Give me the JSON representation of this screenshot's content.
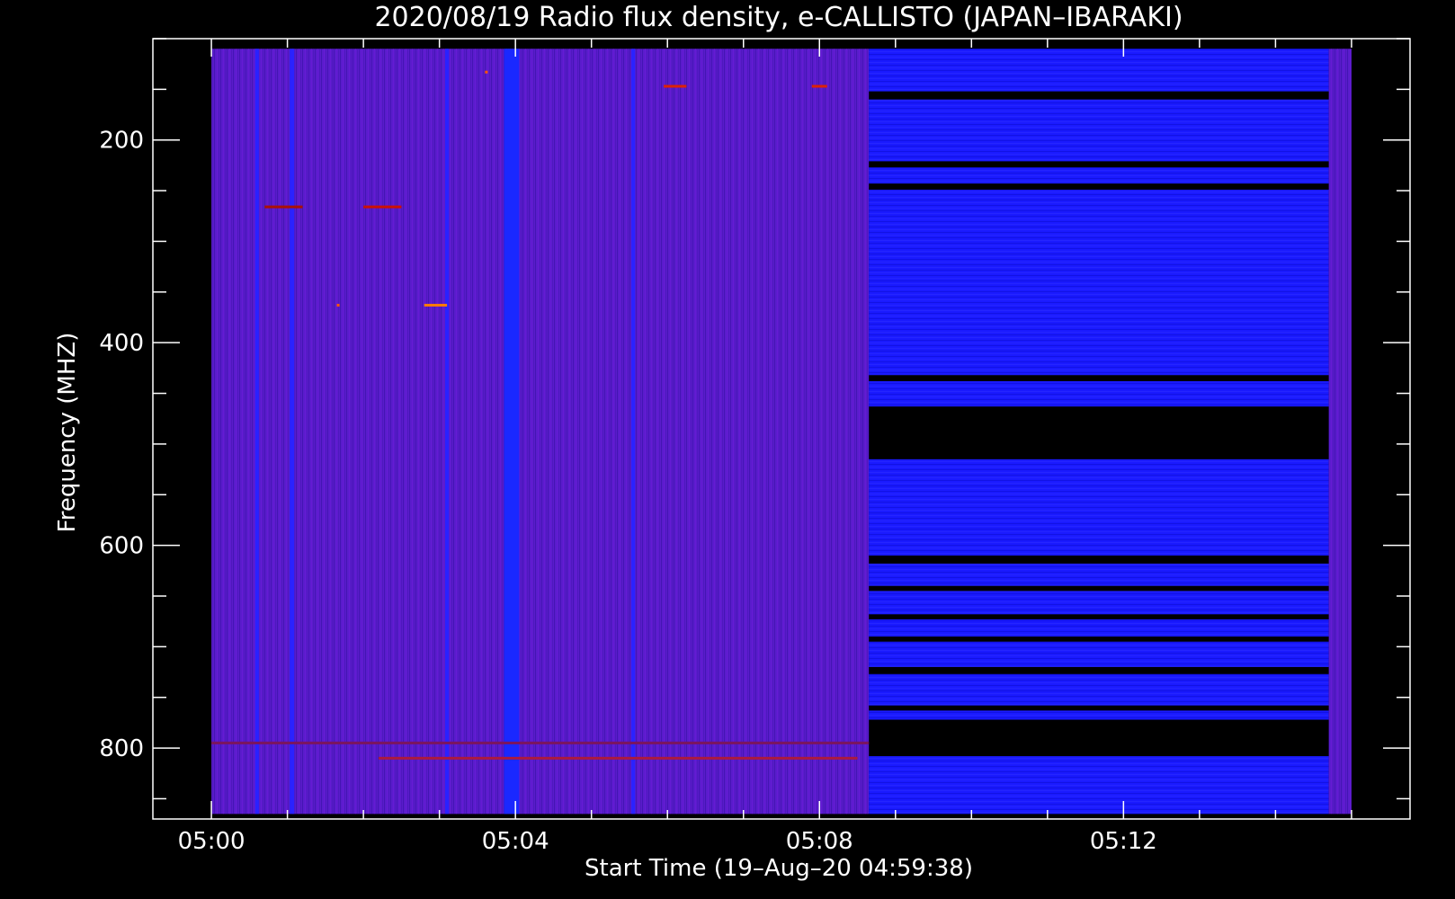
{
  "chart_data": {
    "type": "heatmap",
    "title": "2020/08/19  Radio flux density, e-CALLISTO (JAPAN–IBARAKI)",
    "xlabel": "Start Time (19–Aug–20 04:59:38)",
    "ylabel": "Frequency (MHZ)",
    "x_axis": {
      "unit": "minutes after 05:00",
      "range": [
        -0.77,
        15.77
      ],
      "major_ticks": [
        0,
        4,
        8,
        12
      ],
      "tick_labels": [
        "05:00",
        "05:04",
        "05:08",
        "05:12"
      ],
      "minor_step": 1
    },
    "y_axis": {
      "unit": "MHz",
      "inverted": true,
      "range": [
        100,
        870
      ],
      "major_ticks": [
        200,
        400,
        600,
        800
      ],
      "tick_labels": [
        "200",
        "400",
        "600",
        "800"
      ],
      "minor_step": 50
    },
    "data_extent": {
      "time_start_min": 0,
      "time_end_min": 15.0,
      "freq_min": 110,
      "freq_max": 865
    },
    "segments": [
      {
        "name": "spectrum-part-1",
        "t_start": 0,
        "t_end": 8.65,
        "color": "#5a1ccc"
      },
      {
        "name": "spectrum-part-2",
        "t_start": 8.65,
        "t_end": 14.7,
        "color": "#1a1aff"
      },
      {
        "name": "spectrum-part-3",
        "t_start": 14.7,
        "t_end": 15.0,
        "color": "#5a1ccc"
      }
    ],
    "bright_columns": [
      {
        "t": 3.95,
        "width_min": 0.2,
        "color": "#1a28ff"
      },
      {
        "t": 1.06,
        "width_min": 0.06,
        "color": "#2a22ff"
      },
      {
        "t": 3.1,
        "width_min": 0.05,
        "color": "#2a22ff"
      },
      {
        "t": 5.55,
        "width_min": 0.05,
        "color": "#2a22ff"
      },
      {
        "t": 0.6,
        "width_min": 0.05,
        "color": "#2a22ff"
      }
    ],
    "dark_bands": [
      {
        "f_start": 152,
        "f_end": 160
      },
      {
        "f_start": 221,
        "f_end": 227
      },
      {
        "f_start": 243,
        "f_end": 249
      },
      {
        "f_start": 432,
        "f_end": 438
      },
      {
        "f_start": 463,
        "f_end": 515
      },
      {
        "f_start": 610,
        "f_end": 618
      },
      {
        "f_start": 640,
        "f_end": 645
      },
      {
        "f_start": 668,
        "f_end": 673
      },
      {
        "f_start": 690,
        "f_end": 695
      },
      {
        "f_start": 720,
        "f_end": 727
      },
      {
        "f_start": 758,
        "f_end": 763
      },
      {
        "f_start": 772,
        "f_end": 808
      }
    ],
    "red_markers": [
      {
        "t0": 5.95,
        "t1": 6.25,
        "f": 147,
        "color": "#dd2200"
      },
      {
        "t0": 7.9,
        "t1": 8.1,
        "f": 147,
        "color": "#dd2200"
      },
      {
        "t0": 2.0,
        "t1": 2.5,
        "f": 266,
        "color": "#cc1100"
      },
      {
        "t0": 0.7,
        "t1": 1.2,
        "f": 266,
        "color": "#aa1100"
      },
      {
        "t0": 2.8,
        "t1": 3.1,
        "f": 363,
        "color": "#ff7a00"
      },
      {
        "t0": 1.65,
        "t1": 1.68,
        "f": 363,
        "color": "#ff5500"
      },
      {
        "t0": 3.6,
        "t1": 3.63,
        "f": 133,
        "color": "#ff5500"
      },
      {
        "t0": 0.0,
        "t1": 8.65,
        "f": 795,
        "color": "#7a1560"
      },
      {
        "t0": 2.2,
        "t1": 8.5,
        "f": 810,
        "color": "#aa1a40"
      }
    ],
    "colors": {
      "background": "#000000",
      "axes": "#ffffff",
      "base_purple": "#5a1ccc",
      "base_blue": "#1a1aff"
    }
  }
}
